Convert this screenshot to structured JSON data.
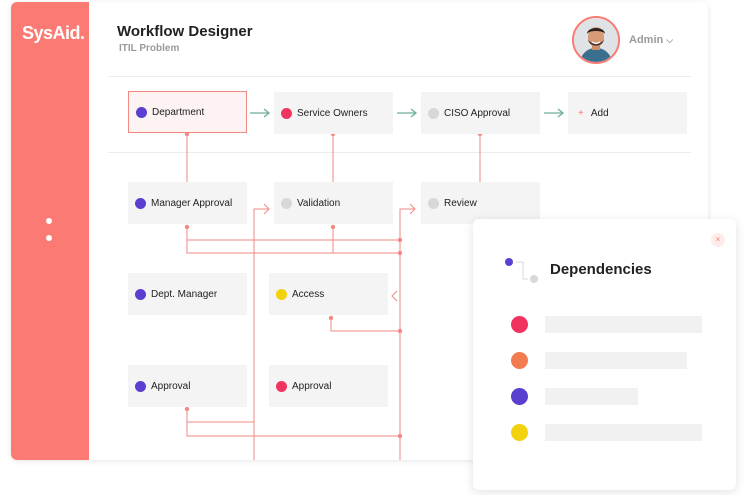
{
  "app": {
    "logo": "SysAid.",
    "title": "Workflow Designer",
    "subtitle": "ITIL Problem"
  },
  "user": {
    "name": "Admin",
    "caret": "⌵"
  },
  "workflow": {
    "top_row": [
      {
        "label": "Department",
        "status_color": "#5b3fd0"
      },
      {
        "label": "Service Owners",
        "status_color": "#f0345f"
      },
      {
        "label": "CISO Approval",
        "status_color": "#d8d8d8"
      },
      {
        "label": "Add",
        "icon": "plus-icon"
      }
    ],
    "row2": [
      {
        "label": "Manager Approval",
        "status_color": "#5b3fd0"
      },
      {
        "label": "Validation",
        "status_color": "#d8d8d8"
      },
      {
        "label": "Review",
        "status_color": "#d8d8d8"
      }
    ],
    "row3": [
      {
        "label": "Dept. Manager",
        "status_color": "#5b3fd0"
      },
      {
        "label": "Access",
        "status_color": "#f2d10e"
      }
    ],
    "row4": [
      {
        "label": "Approval",
        "status_color": "#5b3fd0"
      },
      {
        "label": "Approval",
        "status_color": "#f0345f"
      }
    ]
  },
  "panel": {
    "title": "Dependencies",
    "close": "×",
    "items": [
      {
        "color": "#f0345f"
      },
      {
        "color": "#f27b4f"
      },
      {
        "color": "#5b3fd0"
      },
      {
        "color": "#f2d10e"
      }
    ]
  },
  "colors": {
    "accent": "#fb7a73",
    "wire": "#f28a84",
    "arrow": "#6fae9c"
  }
}
